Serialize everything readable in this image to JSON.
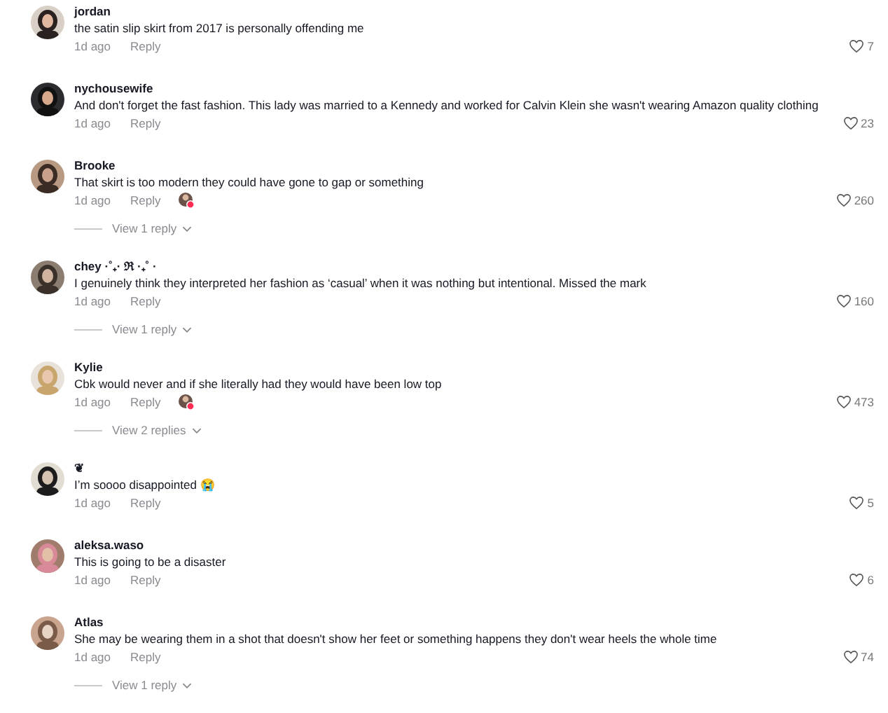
{
  "comments": [
    {
      "username": "jordan",
      "text": "the satin slip skirt from 2017 is personally offending me",
      "time": "1d ago",
      "reply_label": "Reply",
      "likes": "7",
      "creator_liked": false
    },
    {
      "username": "nychousewife",
      "text": "And don't forget the fast fashion. This lady was married to a Kennedy and worked for Calvin Klein she wasn't wearing Amazon quality clothing",
      "time": "1d ago",
      "reply_label": "Reply",
      "likes": "23",
      "creator_liked": false
    },
    {
      "username": "Brooke",
      "text": "That skirt is too modern they could have gone to gap or something",
      "time": "1d ago",
      "reply_label": "Reply",
      "likes": "260",
      "creator_liked": true,
      "view_replies": "View 1 reply"
    },
    {
      "username": "chey ·˚₊· ℜ ·₊˚ ·",
      "text": "I genuinely think they interpreted her fashion as ‘casual’ when it was nothing but intentional. Missed the mark",
      "time": "1d ago",
      "reply_label": "Reply",
      "likes": "160",
      "creator_liked": false,
      "view_replies": "View 1 reply"
    },
    {
      "username": "Kylie",
      "text": "Cbk would never and if she literally had they would have been low top",
      "time": "1d ago",
      "reply_label": "Reply",
      "likes": "473",
      "creator_liked": true,
      "view_replies": "View 2 replies"
    },
    {
      "username": "❦",
      "text": "I’m soooo disappointed 😭",
      "time": "1d ago",
      "reply_label": "Reply",
      "likes": "5",
      "creator_liked": false
    },
    {
      "username": "aleksa.waso",
      "text": "This is going to be a disaster",
      "time": "1d ago",
      "reply_label": "Reply",
      "likes": "6",
      "creator_liked": false
    },
    {
      "username": "Atlas",
      "text": "She may be wearing them in a shot that doesn't show her feet or something happens they don't wear heels the whole time",
      "time": "1d ago",
      "reply_label": "Reply",
      "likes": "74",
      "creator_liked": false,
      "view_replies": "View 1 reply"
    }
  ]
}
